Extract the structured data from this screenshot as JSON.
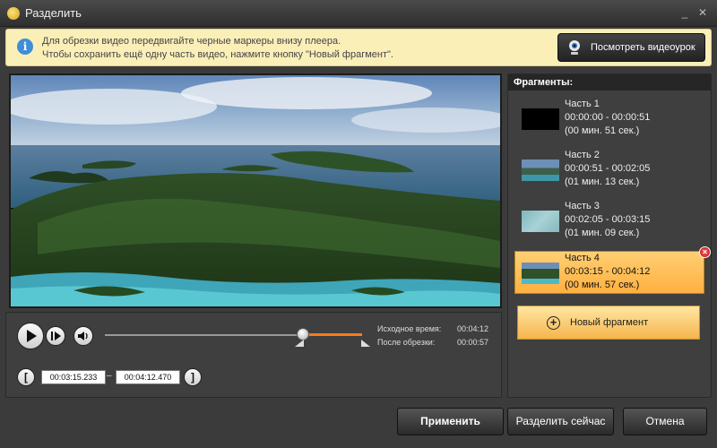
{
  "window": {
    "title": "Разделить"
  },
  "info": {
    "line1": "Для обрезки видео передвигайте черные маркеры внизу плеера.",
    "line2": "Чтобы сохранить ещё одну часть видео, нажмите кнопку \"Новый фрагмент\".",
    "tutorial_button": "Посмотреть видеоурок"
  },
  "player": {
    "original_time_label": "Исходное время:",
    "original_time": "00:04:12",
    "after_trim_label": "После обрезки:",
    "after_trim": "00:00:57",
    "start_time": "00:03:15.233",
    "end_time": "00:04:12.470",
    "dash": "–",
    "bracket_left": "[",
    "bracket_right": "]"
  },
  "fragments": {
    "header": "Фрагменты:",
    "items": [
      {
        "name": "Часть 1",
        "range": "00:00:00 - 00:00:51",
        "duration": "(00 мин. 51 сек.)"
      },
      {
        "name": "Часть 2",
        "range": "00:00:51 - 00:02:05",
        "duration": "(01 мин. 13 сек.)"
      },
      {
        "name": "Часть 3",
        "range": "00:02:05 - 00:03:15",
        "duration": "(01 мин. 09 сек.)"
      },
      {
        "name": "Часть 4",
        "range": "00:03:15 - 00:04:12",
        "duration": "(00 мин. 57 сек.)"
      }
    ],
    "new_fragment": "Новый фрагмент"
  },
  "buttons": {
    "apply": "Применить",
    "split_now": "Разделить сейчас",
    "cancel": "Отмена"
  },
  "icons": {
    "minimize": "minimize-icon",
    "close": "close-icon",
    "info": "info-icon",
    "webcam": "webcam-icon"
  },
  "colors": {
    "accent": "#ff7a1a",
    "selected_fragment": "#ffb040",
    "info_bar": "#fbefb8"
  }
}
